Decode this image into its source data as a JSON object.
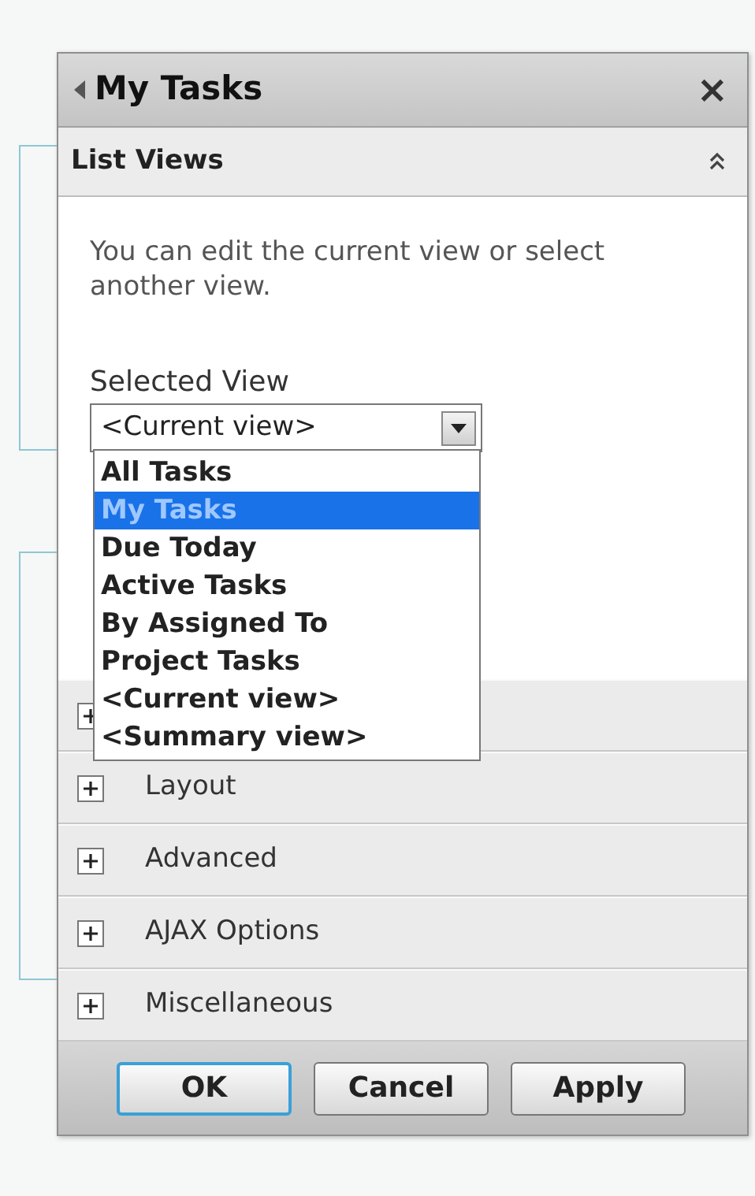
{
  "panel": {
    "title": "My Tasks",
    "close_symbol": "×"
  },
  "list_views": {
    "title": "List Views",
    "expanded": true,
    "description": "You can edit the current view or select another view.",
    "field_label": "Selected View",
    "select_value": "<Current view>",
    "dropdown_open": true,
    "options": [
      {
        "label": "All Tasks",
        "selected": false
      },
      {
        "label": "My Tasks",
        "selected": true
      },
      {
        "label": "Due Today",
        "selected": false
      },
      {
        "label": "Active Tasks",
        "selected": false
      },
      {
        "label": "By Assigned To",
        "selected": false
      },
      {
        "label": "Project Tasks",
        "selected": false
      },
      {
        "label": "<Current view>",
        "selected": false
      },
      {
        "label": "<Summary view>",
        "selected": false
      }
    ]
  },
  "sections": [
    {
      "expanded": false
    },
    {
      "title": "Layout",
      "expanded": false
    },
    {
      "title": "Advanced",
      "expanded": false
    },
    {
      "title": "AJAX Options",
      "expanded": false
    },
    {
      "title": "Miscellaneous",
      "expanded": false
    }
  ],
  "buttons": [
    {
      "label": "OK",
      "focused": true
    },
    {
      "label": "Cancel",
      "focused": false
    },
    {
      "label": "Apply",
      "focused": false
    }
  ]
}
